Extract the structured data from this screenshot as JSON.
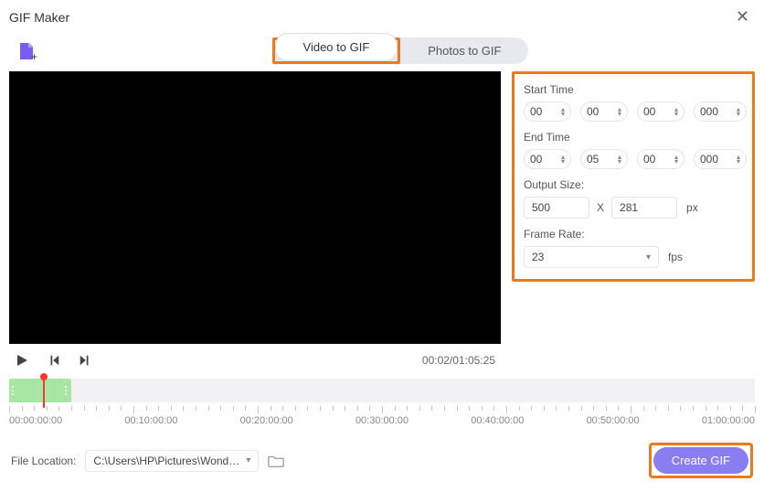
{
  "window": {
    "title": "GIF Maker"
  },
  "tabs": {
    "video": "Video to GIF",
    "photos": "Photos to GIF",
    "active": "video"
  },
  "settings": {
    "startLabel": "Start Time",
    "start": {
      "h": "00",
      "m": "00",
      "s": "00",
      "ms": "000"
    },
    "endLabel": "End Time",
    "end": {
      "h": "00",
      "m": "05",
      "s": "00",
      "ms": "000"
    },
    "outputSizeLabel": "Output Size:",
    "outputSize": {
      "w": "500",
      "h": "281",
      "unit": "px",
      "by": "X"
    },
    "frameRateLabel": "Frame Rate:",
    "frameRate": {
      "value": "23",
      "unit": "fps"
    }
  },
  "player": {
    "elapsed": "00:02",
    "total": "01:05:25",
    "sep": "/"
  },
  "timeline": {
    "marks": [
      "00:00:00:00",
      "00:10:00:00",
      "00:20:00:00",
      "00:30:00:00",
      "00:40:00:00",
      "00:50:00:00",
      "01:00:00:00"
    ]
  },
  "fileLocation": {
    "label": "File Location:",
    "path": "C:\\Users\\HP\\Pictures\\Wondersh"
  },
  "actions": {
    "create": "Create GIF"
  }
}
